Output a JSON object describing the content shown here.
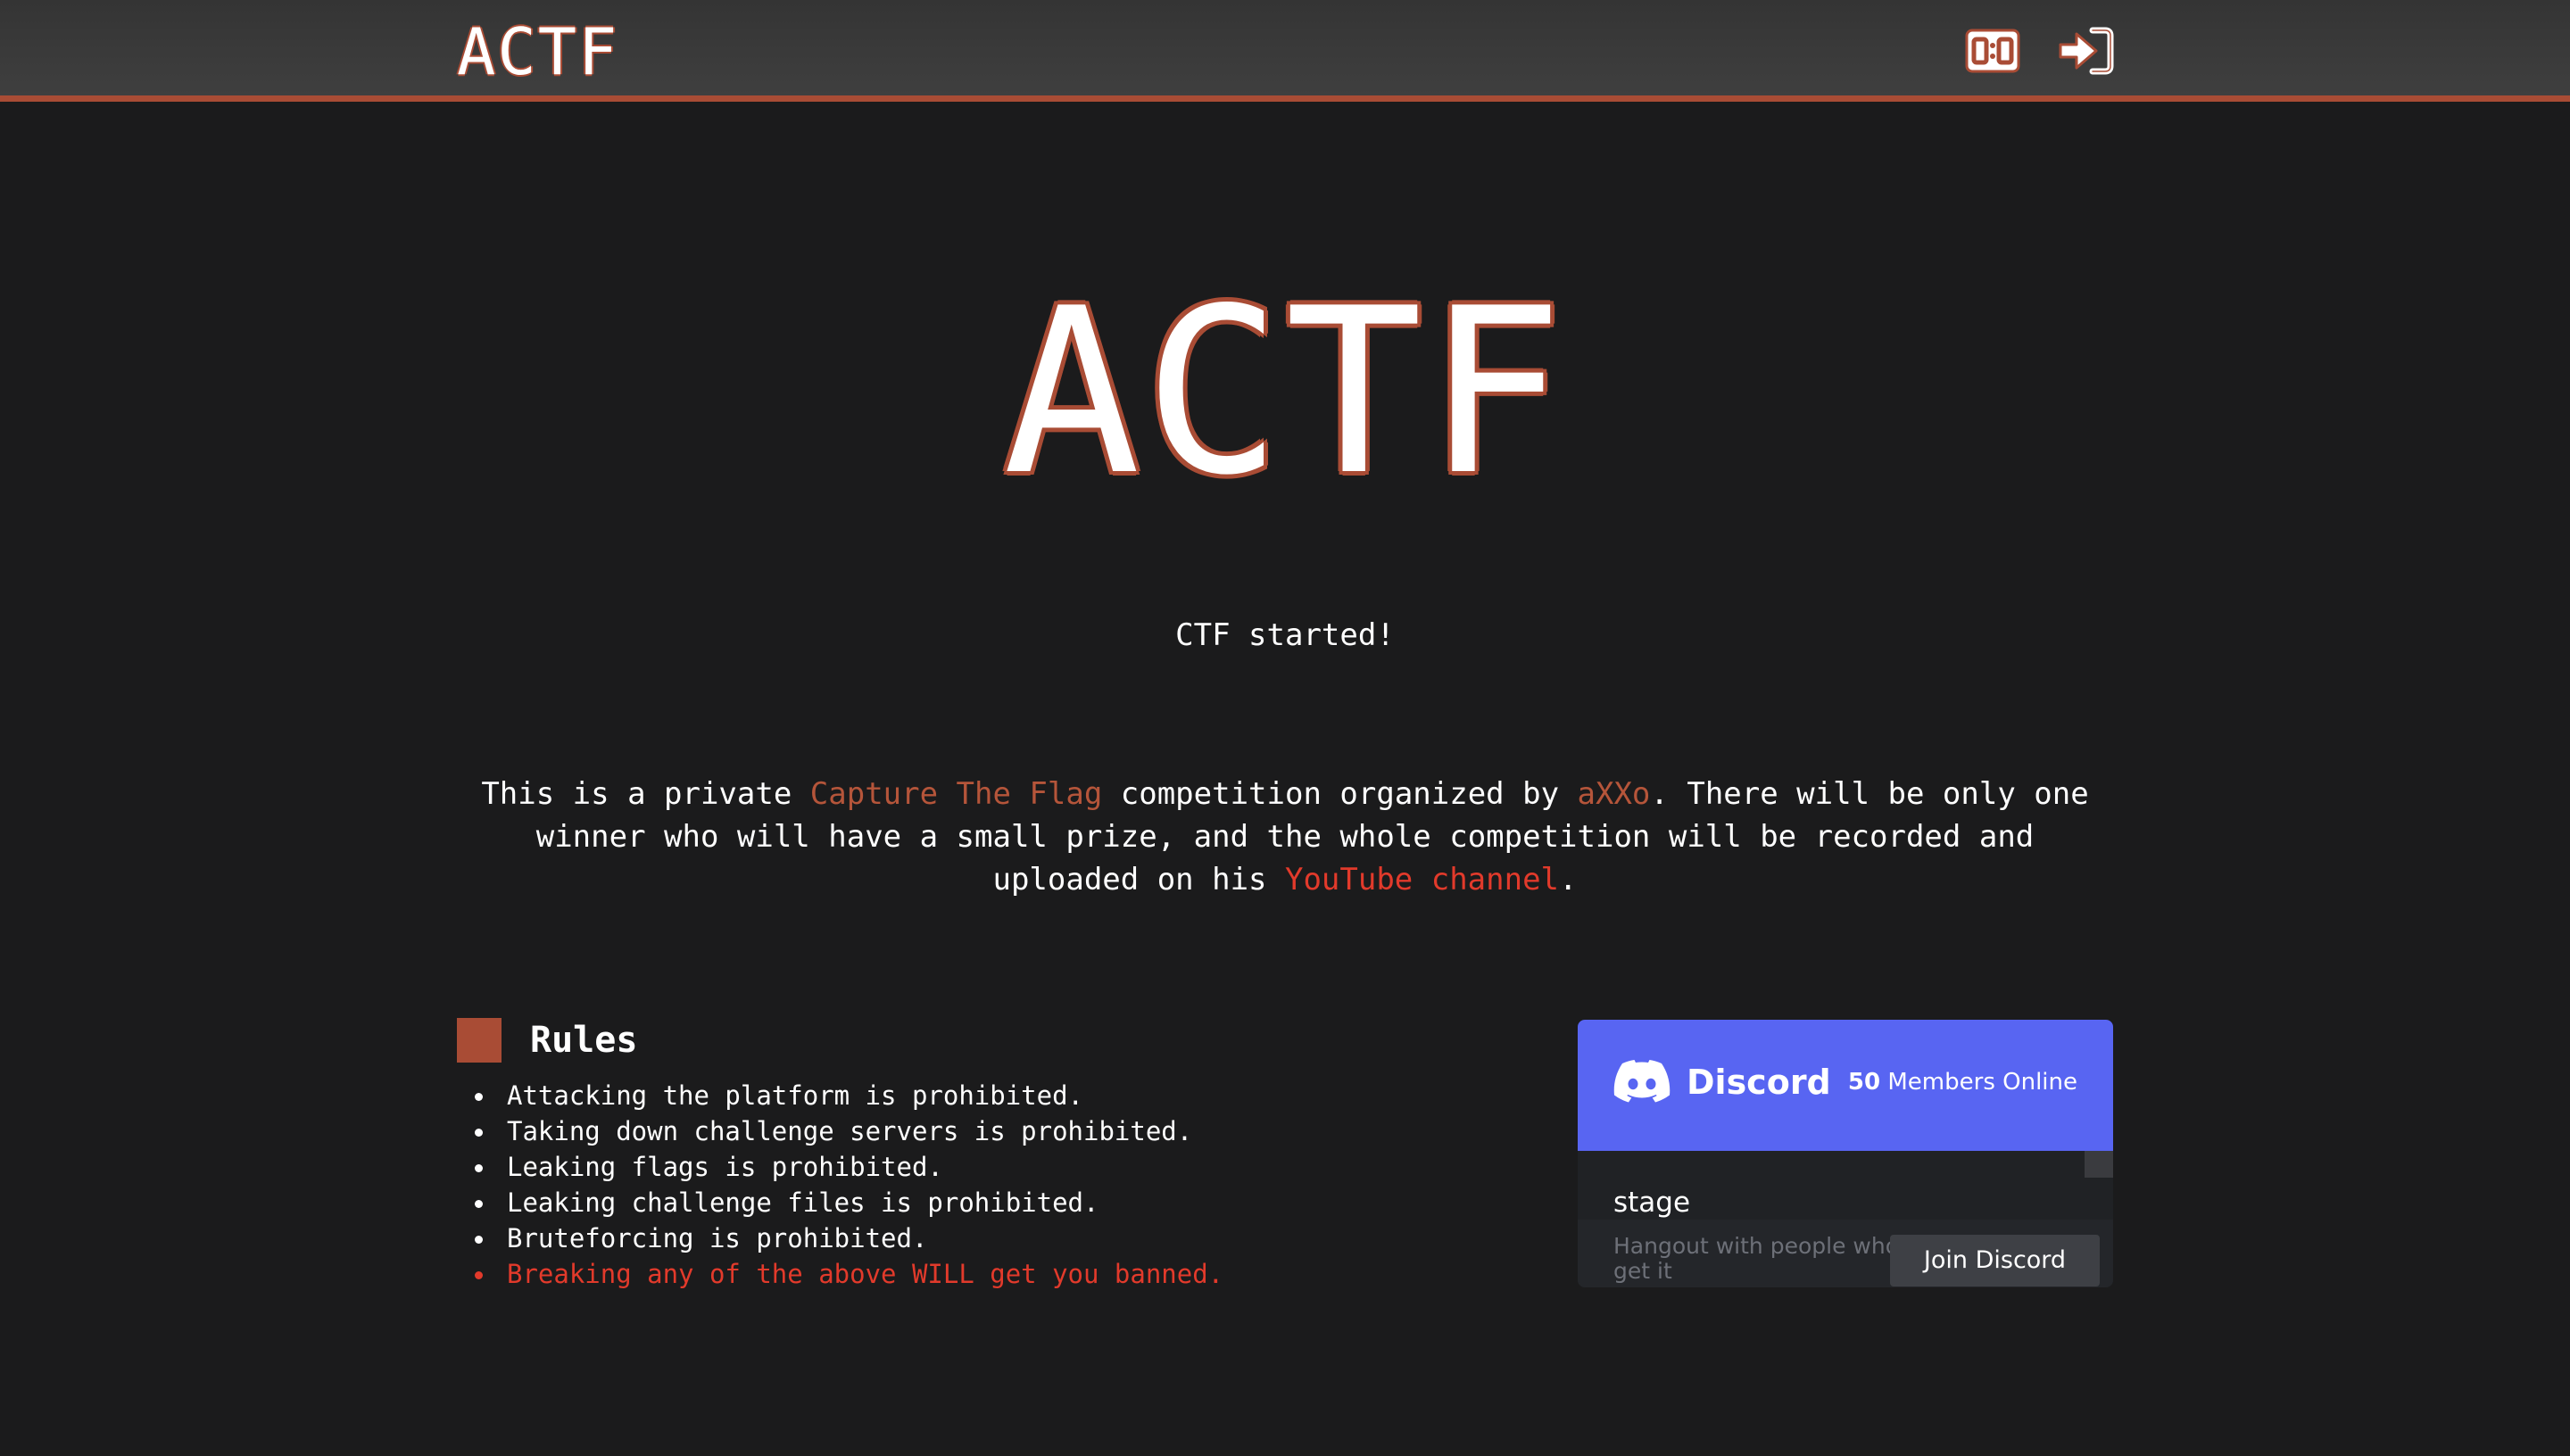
{
  "navbar": {
    "brand": "ACTF",
    "icons": [
      {
        "name": "scoreboard-icon"
      },
      {
        "name": "login-icon"
      }
    ]
  },
  "hero": {
    "title": "ACTF"
  },
  "status": "CTF started!",
  "intro": {
    "part1": "This is a private ",
    "link1": "Capture The Flag",
    "part2": " competition organized by ",
    "link2": "aXXo",
    "part3": ". There will be only one winner who will have a small prize, and the whole competition will be recorded and uploaded on his ",
    "link3": "YouTube channel",
    "part4": "."
  },
  "rules": {
    "title": "Rules",
    "items": [
      "Attacking the platform is prohibited.",
      "Taking down challenge servers is prohibited.",
      "Leaking flags is prohibited.",
      "Leaking challenge files is prohibited.",
      "Bruteforcing is prohibited.",
      "Breaking any of the above WILL get you banned."
    ]
  },
  "discord": {
    "wordmark": "Discord",
    "online_count": "50",
    "online_label": " Members Online",
    "channel": "stage",
    "tagline": "Hangout with people who get it",
    "join_label": "Join Discord"
  },
  "colors": {
    "accent": "#a94c35",
    "link_orange": "#b5553a",
    "link_red": "#e23a2b",
    "background": "#1b1b1c",
    "discord_blurple": "#5865f2"
  }
}
